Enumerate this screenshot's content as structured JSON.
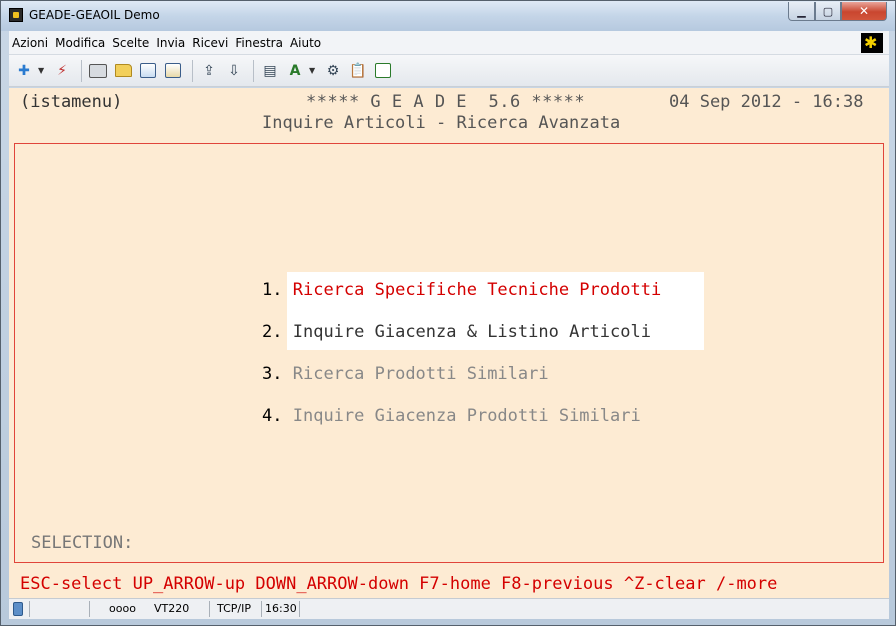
{
  "window": {
    "title": "GEADE-GEAOIL Demo"
  },
  "menubar": {
    "items": [
      {
        "label": "Azioni"
      },
      {
        "label": "Modifica"
      },
      {
        "label": "Scelte"
      },
      {
        "label": "Invia"
      },
      {
        "label": "Ricevi"
      },
      {
        "label": "Finestra"
      },
      {
        "label": "Aiuto"
      }
    ]
  },
  "terminal": {
    "header_left": "(istamenu)",
    "header_center": "***** G E A D E  5.6 *****",
    "header_right": "04 Sep 2012 - 16:38",
    "subtitle": "Inquire Articoli - Ricerca Avanzata",
    "options": [
      {
        "num": "1.",
        "label": "Ricerca Specifiche Tecniche Prodotti"
      },
      {
        "num": "2.",
        "label": "Inquire Giacenza & Listino Articoli"
      },
      {
        "num": "3.",
        "label": "Ricerca Prodotti Similari"
      },
      {
        "num": "4.",
        "label": "Inquire Giacenza Prodotti Similari"
      }
    ],
    "selection_label": "SELECTION:",
    "function_keys": "ESC-select UP_ARROW-up DOWN_ARROW-down F7-home F8-previous ^Z-clear /-more"
  },
  "statusbar": {
    "leds": "oooo",
    "emulation": "VT220",
    "protocol": "TCP/IP",
    "time": "16:30"
  },
  "colors": {
    "terminal_bg": "#fdebd3",
    "highlight": "#d40000",
    "frame": "#e0443a"
  }
}
